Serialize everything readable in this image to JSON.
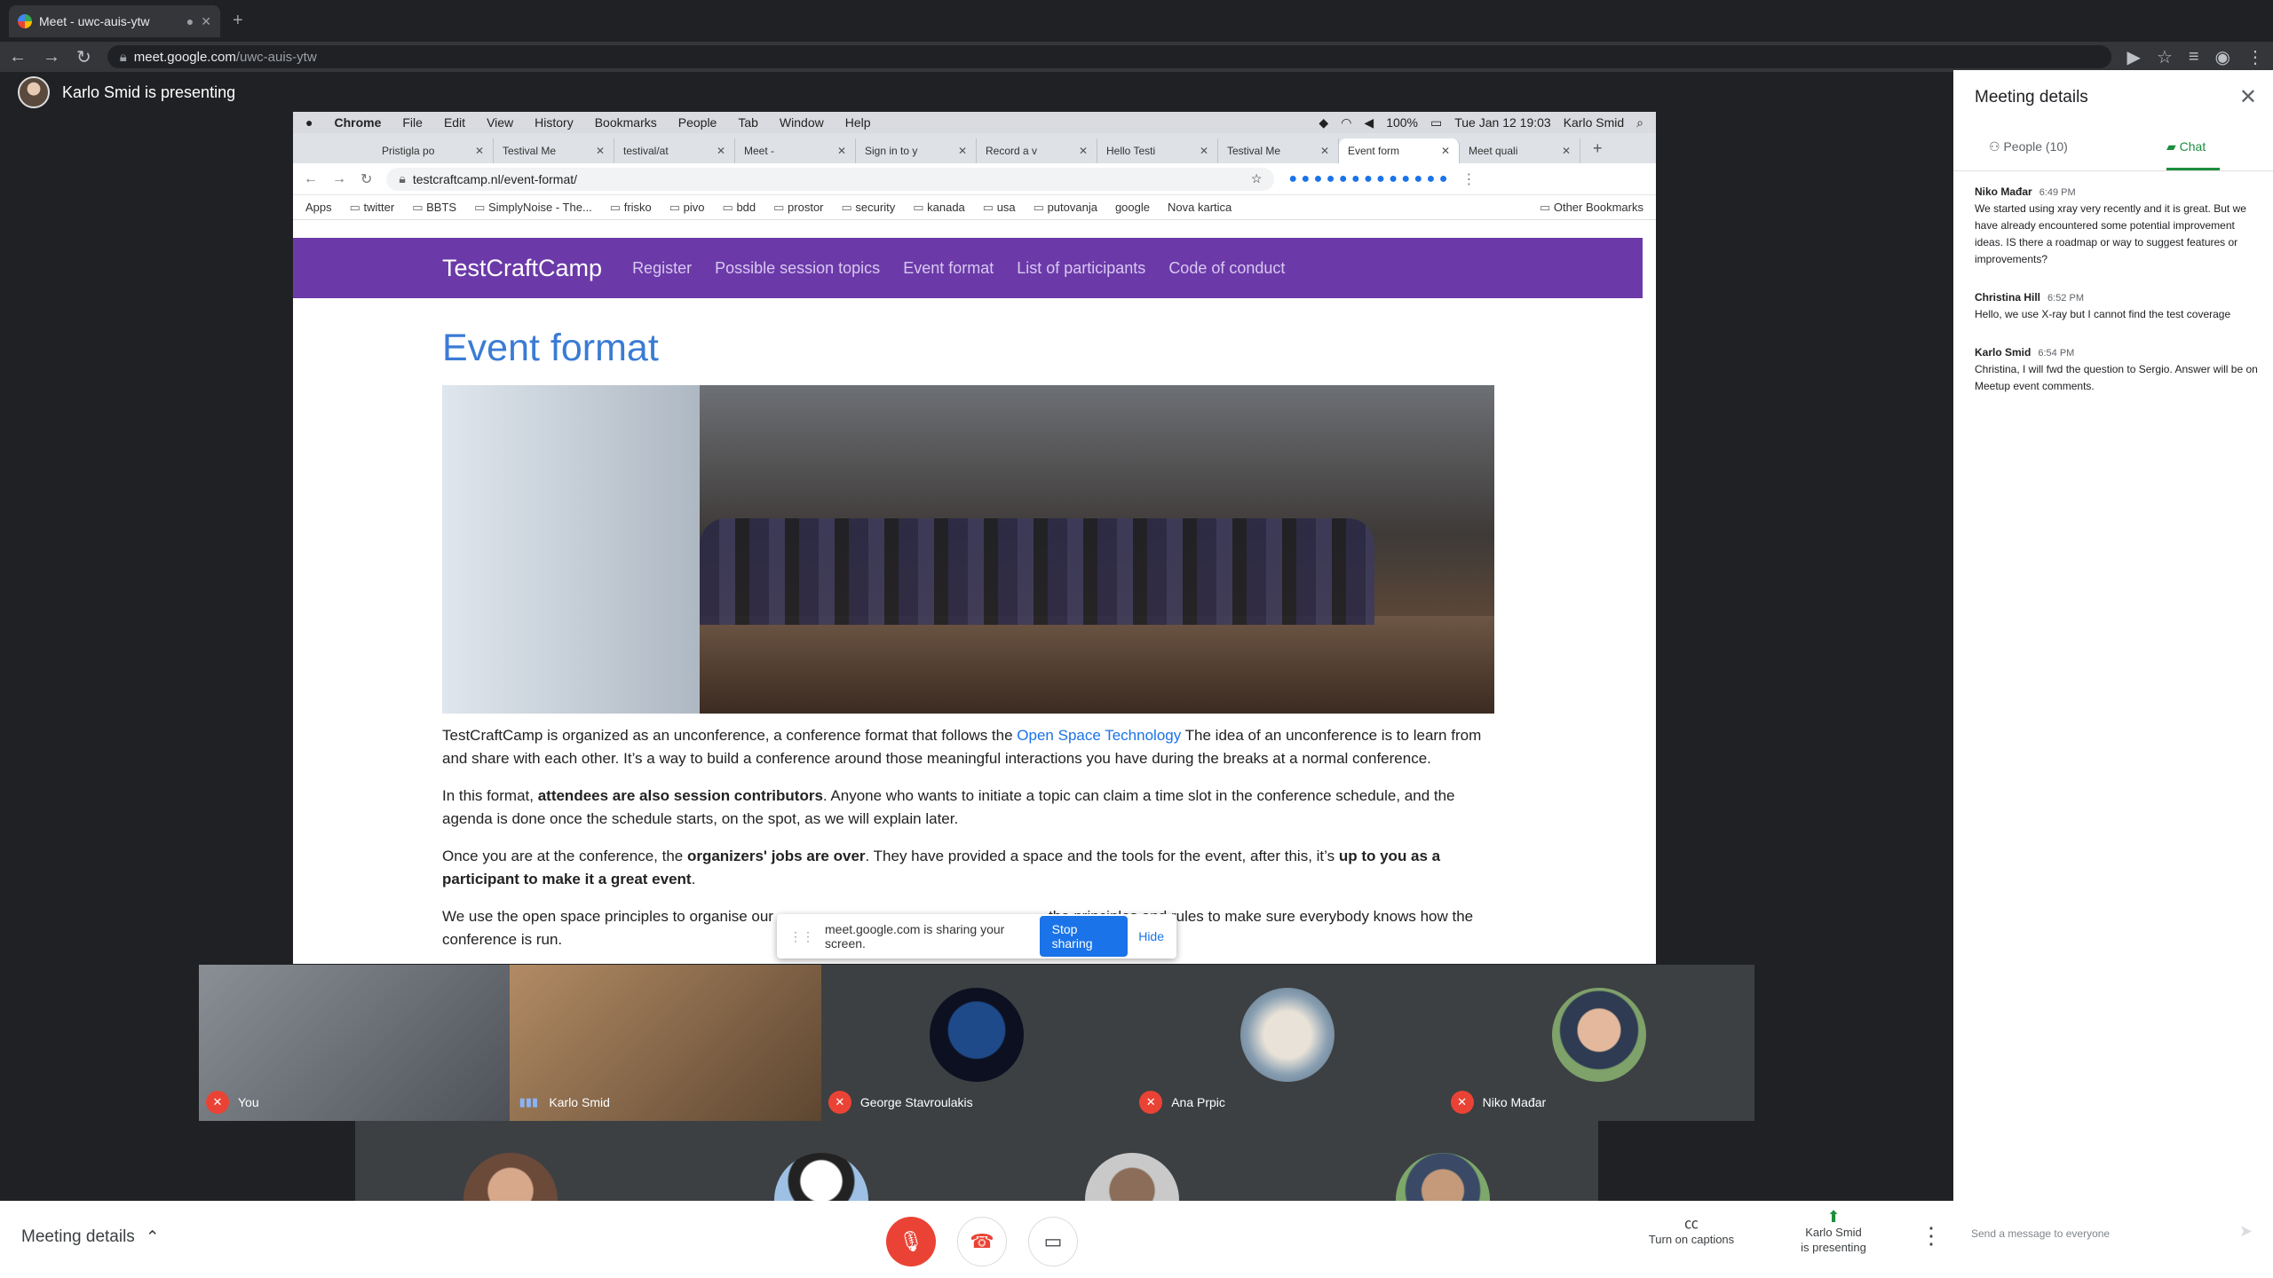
{
  "outer_browser": {
    "tab_title": "Meet - uwc-auis-ytw",
    "url_host": "meet.google.com",
    "url_path": "/uwc-auis-ytw"
  },
  "presenter": {
    "text": "Karlo Smid is presenting"
  },
  "mac_menu": {
    "items": [
      "Chrome",
      "File",
      "Edit",
      "View",
      "History",
      "Bookmarks",
      "People",
      "Tab",
      "Window",
      "Help"
    ],
    "battery": "100%",
    "datetime": "Tue Jan 12  19:03",
    "user": "Karlo Smid"
  },
  "inner_tabs": [
    "Pristigla po",
    "Testival Me",
    "testival/at",
    "Meet -",
    "Sign in to y",
    "Record a v",
    "Hello Testi",
    "Testival Me",
    "Event form",
    "Meet quali"
  ],
  "inner_url": "testcraftcamp.nl/event-format/",
  "bookmarks": [
    "Apps",
    "twitter",
    "BBTS",
    "SimplyNoise - The...",
    "frisko",
    "pivo",
    "bdd",
    "prostor",
    "security",
    "kanada",
    "usa",
    "putovanja",
    "google",
    "Nova kartica",
    "Other Bookmarks"
  ],
  "site": {
    "brand": "TestCraftCamp",
    "nav": [
      "Register",
      "Possible session topics",
      "Event format",
      "List of participants",
      "Code of conduct"
    ],
    "title": "Event format",
    "p1_a": "TestCraftCamp is organized as an unconference, a conference format that follows the ",
    "p1_link": "Open Space Technology",
    "p1_b": " The idea of an unconference is to learn from and share with each other. It’s a way to build a conference around those meaningful interactions you have during the breaks at a normal conference.",
    "p2_a": "In this format, ",
    "p2_bold": "attendees are also session contributors",
    "p2_b": ". Anyone who wants to initiate a topic can claim a time slot in the conference schedule, and the agenda is done once the schedule starts, on the spot, as we will explain later.",
    "p3_a": "Once you are at the conference, the ",
    "p3_bold1": "organizers' jobs are over",
    "p3_b": ". They have provided a space and the tools for the event, after this, it’s ",
    "p3_bold2": "up to you as a participant to make it a great event",
    "p3_c": ".",
    "p4_a": "We use the open space principles to organise our",
    "p4_b": "the principles and rules to make sure everybody knows how the conference is run."
  },
  "sharebar": {
    "text": "meet.google.com is sharing your screen.",
    "stop": "Stop sharing",
    "hide": "Hide"
  },
  "participants": [
    {
      "name": "You",
      "mic": "muted"
    },
    {
      "name": "Karlo Smid",
      "mic": "speaking"
    },
    {
      "name": "George Stavroulakis",
      "mic": "muted"
    },
    {
      "name": "Ana Prpic",
      "mic": "muted"
    },
    {
      "name": "Niko Mađar",
      "mic": "muted"
    }
  ],
  "bottom": {
    "meeting_details": "Meeting details",
    "captions": "Turn on captions",
    "presenting_line1": "Karlo Smid",
    "presenting_line2": "is presenting"
  },
  "panel": {
    "title": "Meeting details",
    "people_tab": "People (10)",
    "chat_tab": "Chat",
    "messages": [
      {
        "author": "Niko Mađar",
        "time": "6:49 PM",
        "text": "We started using xray very recently and it is great. But we have already encountered some potential improvement ideas. IS there a roadmap or way to suggest features or improvements?"
      },
      {
        "author": "Christina Hill",
        "time": "6:52 PM",
        "text": "Hello, we use X-ray but I cannot find the test coverage"
      },
      {
        "author": "Karlo Smid",
        "time": "6:54 PM",
        "text": "Christina, I will fwd the question to Sergio. Answer will be on Meetup event comments."
      }
    ],
    "input_placeholder": "Send a message to everyone"
  },
  "colors": {
    "meet_green": "#1e8e3e",
    "mute_red": "#ea4335",
    "site_purple": "#6b3aa8",
    "title_blue": "#3a7bd5"
  }
}
